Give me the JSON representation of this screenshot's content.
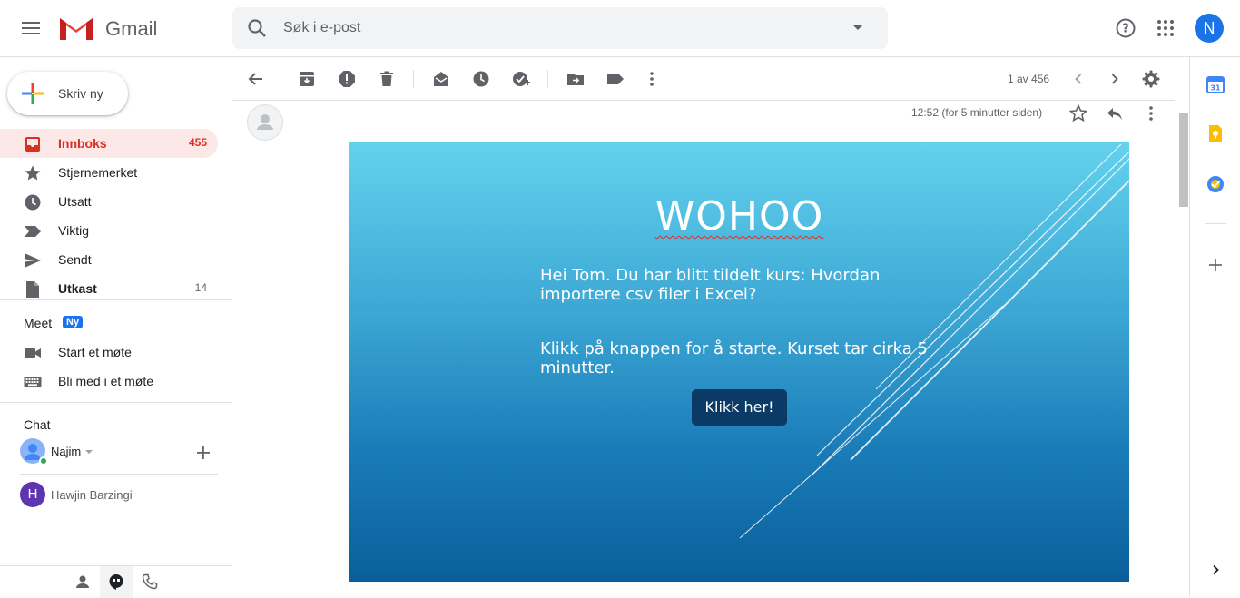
{
  "header": {
    "app_name": "Gmail",
    "search_placeholder": "Søk i e-post",
    "account_initial": "N"
  },
  "sidebar": {
    "compose_label": "Skriv ny",
    "items": [
      {
        "label": "Innboks",
        "count": "455",
        "icon": "inbox-icon"
      },
      {
        "label": "Stjernemerket",
        "count": "",
        "icon": "star-icon"
      },
      {
        "label": "Utsatt",
        "count": "",
        "icon": "clock-icon"
      },
      {
        "label": "Viktig",
        "count": "",
        "icon": "label-important-icon"
      },
      {
        "label": "Sendt",
        "count": "",
        "icon": "send-icon"
      },
      {
        "label": "Utkast",
        "count": "14",
        "icon": "draft-icon"
      }
    ],
    "meet": {
      "title": "Meet",
      "badge": "Ny",
      "start": "Start et møte",
      "join": "Bli med i et møte"
    },
    "chat": {
      "title": "Chat",
      "users": [
        {
          "name": "Najim",
          "initial": ""
        },
        {
          "name": "Hawjin Barzingi",
          "initial": "H"
        }
      ]
    }
  },
  "toolbar": {
    "pager": "1 av 456"
  },
  "message": {
    "timestamp": "12:52 (for 5 minutter siden)",
    "banner": {
      "title": "WOHOO",
      "line1_a": "Hei Tom. Du har blitt tildelt kurs: Hvordan",
      "line1_b": "importere csv filer i Excel?",
      "line2_a": "Klikk på knappen for å starte. Kurset tar cirka 5",
      "line2_b": "minutter.",
      "button": "Klikk her!"
    }
  },
  "colors": {
    "accent_red": "#d93025",
    "brand_blue": "#1a73e8",
    "button_navy": "#0b3a66"
  }
}
